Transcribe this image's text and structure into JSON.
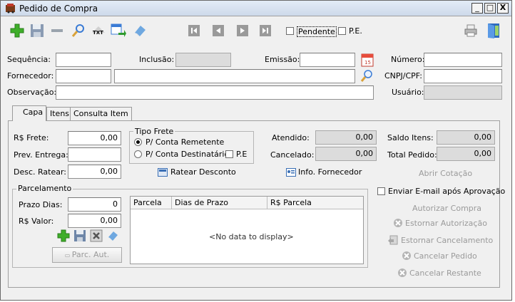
{
  "window": {
    "title": "Pedido de Compra",
    "minimize": "_",
    "maximize": "□",
    "close": "X"
  },
  "toolbar": {
    "pendente_label": "Pendente",
    "pe_label": "P.E."
  },
  "header_fields": {
    "sequencia_label": "Sequência:",
    "inclusao_label": "Inclusão:",
    "emissao_label": "Emissão:",
    "numero_label": "Número:",
    "fornecedor_label": "Fornecedor:",
    "cnpj_label": "CNPJ/CPF:",
    "observacao_label": "Observação:",
    "usuario_label": "Usuário:"
  },
  "tabs": [
    "Capa",
    "Itens",
    "Consulta Item"
  ],
  "capa": {
    "frete_label": "R$ Frete:",
    "frete_value": "0,00",
    "prev_entrega_label": "Prev. Entrega:",
    "desc_ratear_label": "Desc. Ratear:",
    "desc_ratear_value": "0,00",
    "tipo_frete_title": "Tipo Frete",
    "remetente_label": "P/ Conta Remetente",
    "destinatario_label": "P/ Conta Destinatário",
    "pe_label": "P.E",
    "ratear_desconto_label": "Ratear Desconto",
    "atendido_label": "Atendido:",
    "atendido_value": "0,00",
    "cancelado_label": "Cancelado:",
    "cancelado_value": "0,00",
    "info_fornecedor_label": "Info. Fornecedor",
    "saldo_itens_label": "Saldo Itens:",
    "saldo_itens_value": "0,00",
    "total_pedido_label": "Total Pedido:",
    "total_pedido_value": "0,00",
    "abrir_cotacao_label": "Abrir Cotação"
  },
  "parcelamento": {
    "title": "Parcelamento",
    "prazo_dias_label": "Prazo Dias:",
    "prazo_dias_value": "0",
    "valor_label": "R$ Valor:",
    "valor_value": "0,00",
    "parc_aut_label": "Parc. Aut.",
    "grid_columns": [
      "Parcela",
      "Dias de Prazo",
      "R$ Parcela"
    ],
    "grid_empty": "<No data to display>"
  },
  "actions": {
    "enviar_email_label": "Enviar E-mail após Aprovação",
    "autorizar_compra": "Autorizar Compra",
    "estornar_autorizacao": "Estornar Autorização",
    "estornar_cancelamento": "Estornar Cancelamento",
    "cancelar_pedido": "Cancelar Pedido",
    "cancelar_restante": "Cancelar Restante"
  }
}
